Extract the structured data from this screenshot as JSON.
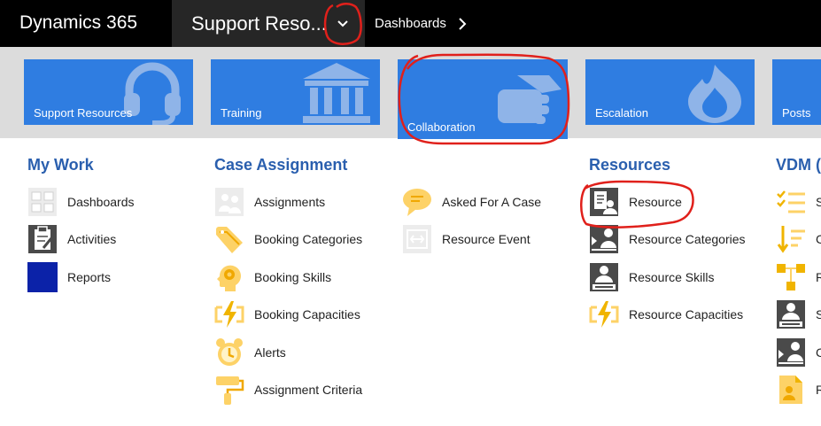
{
  "header": {
    "brand": "Dynamics 365",
    "area_label": "Support Reso...",
    "breadcrumb": "Dashboards"
  },
  "tiles": [
    {
      "label": "Support Resources",
      "icon": "headset-icon"
    },
    {
      "label": "Training",
      "icon": "bank-building-icon"
    },
    {
      "label": "Collaboration",
      "icon": "handshake-icon",
      "selected": true
    },
    {
      "label": "Escalation",
      "icon": "flame-icon"
    },
    {
      "label": "Posts",
      "icon": "post-icon"
    }
  ],
  "groups": {
    "my_work": {
      "title": "My Work",
      "items": [
        {
          "label": "Dashboards",
          "icon": "dashboard-icon"
        },
        {
          "label": "Activities",
          "icon": "clipboard-icon"
        },
        {
          "label": "Reports",
          "icon": "report-icon"
        }
      ]
    },
    "case_assignment": {
      "title": "Case Assignment",
      "items": [
        {
          "label": "Assignments",
          "icon": "assignments-icon"
        },
        {
          "label": "Booking Categories",
          "icon": "tag-icon"
        },
        {
          "label": "Booking Skills",
          "icon": "head-gear-icon"
        },
        {
          "label": "Booking Capacities",
          "icon": "lightning-icon"
        },
        {
          "label": "Alerts",
          "icon": "alarm-clock-icon"
        },
        {
          "label": "Assignment Criteria",
          "icon": "paint-roller-icon"
        }
      ],
      "items_col2": [
        {
          "label": "Asked For A Case",
          "icon": "speech-bubble-icon"
        },
        {
          "label": "Resource Event",
          "icon": "event-icon"
        }
      ]
    },
    "resources": {
      "title": "Resources",
      "items": [
        {
          "label": "Resource",
          "icon": "resource-icon"
        },
        {
          "label": "Resource Categories",
          "icon": "resource-categories-icon"
        },
        {
          "label": "Resource Skills",
          "icon": "resource-skills-icon"
        },
        {
          "label": "Resource Capacities",
          "icon": "lightning-icon"
        }
      ]
    },
    "vdm": {
      "title": "VDM (",
      "items": [
        {
          "label": "S",
          "icon": "checklist-icon"
        },
        {
          "label": "C",
          "icon": "sort-down-icon"
        },
        {
          "label": "R",
          "icon": "org-chart-icon"
        },
        {
          "label": "S",
          "icon": "resource-skills-icon"
        },
        {
          "label": "C",
          "icon": "resource-categories-icon"
        },
        {
          "label": "R",
          "icon": "contact-card-icon"
        }
      ]
    }
  },
  "colors": {
    "accent": "#2f7de1",
    "group_title": "#2a5fae",
    "annotation": "#e0201b"
  }
}
